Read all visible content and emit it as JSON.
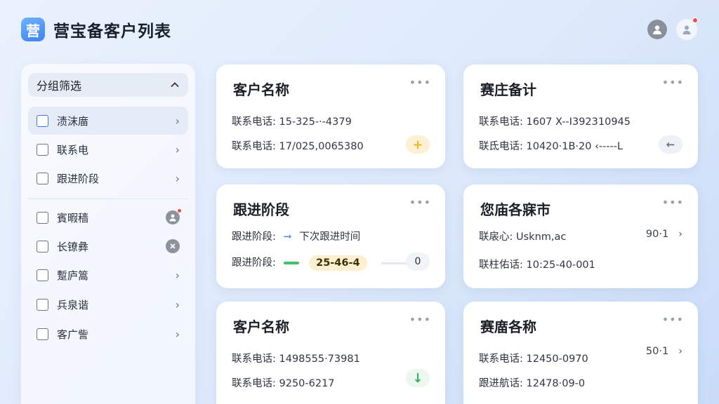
{
  "app": {
    "logo_glyph": "营",
    "title": "营宝备客户列表"
  },
  "sidebar": {
    "header": "分组筛选",
    "items": [
      {
        "label": "渍沫庿"
      },
      {
        "label": "联系电"
      },
      {
        "label": "跟进阶段"
      },
      {
        "label": "賓暇穑"
      },
      {
        "label": "长镣彝"
      },
      {
        "label": "蹔庐篙"
      },
      {
        "label": "兵泉谐"
      },
      {
        "label": "客广訾"
      }
    ]
  },
  "cards": [
    {
      "title": "客户名称",
      "more": "•••",
      "rows": [
        {
          "label": "联系电话:",
          "value": "15-325-·-4379"
        },
        {
          "label": "联系电话:",
          "value": "17/025,0065380"
        }
      ],
      "action_icon": "+"
    },
    {
      "title": "赛庄备计",
      "more": "•••",
      "rows": [
        {
          "label": "联系电话:",
          "value": "1607 X--I392310945"
        },
        {
          "label": "联氐电话:",
          "value": "10420·1B·20 ‹---‑‑L"
        }
      ],
      "action_icon": "←"
    },
    {
      "title": "跟进阶段",
      "more": "•••",
      "row1_label": "跟进阶段:",
      "row1_target": "下次跟进时间",
      "row2_label": "跟进阶段:",
      "row2_tag": "25-46-4",
      "row2_count": "0"
    },
    {
      "title": "您庙各寐市",
      "more": "•••",
      "rows": [
        {
          "label": "联扆心:",
          "value": "Usknm,ac"
        },
        {
          "label": "联柱佑话:",
          "value": "10:25-40-001"
        }
      ],
      "side_number": "90·1",
      "side_chev": "›"
    },
    {
      "title": "客户名称",
      "more": "•••",
      "rows": [
        {
          "label": "联系电话:",
          "value": "1498555·73981"
        },
        {
          "label": "联系电话:",
          "value": "9250-6217"
        }
      ],
      "action_icon": "↓"
    },
    {
      "title": "赛庿各称",
      "more": "•••",
      "rows": [
        {
          "label": "联系电话:",
          "value": "12450-0970"
        },
        {
          "label": "跟进航话:",
          "value": "12478·09-0"
        }
      ],
      "side_number": "50·1",
      "side_chev": "›"
    }
  ],
  "colors": {
    "accent": "#3c82f0",
    "notify": "#ef4c43",
    "progress": "#42c06a",
    "warning": "#f6b21e"
  }
}
